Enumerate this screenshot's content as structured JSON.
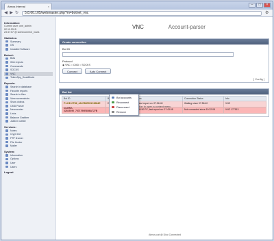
{
  "browser": {
    "tab_title": "Atmos Internal",
    "url": "5.8.60.105/webmaster.php?m=botnet_vnc"
  },
  "sidebar": {
    "info_heading": "Information:",
    "info_lines": [
      "Current user: one_admin",
      "02.11.2015",
      "23:47:57 @ someconnect_nows"
    ],
    "sections": [
      {
        "heading": "Statistics:",
        "items": [
          {
            "label": "Summary"
          },
          {
            "label": "OS"
          },
          {
            "label": "Installed Software"
          }
        ]
      },
      {
        "heading": "Botnet:",
        "items": [
          {
            "label": "Bots"
          },
          {
            "label": "Web Injects"
          },
          {
            "label": "Commands"
          },
          {
            "label": "SOCKS"
          },
          {
            "label": "VNC",
            "active": true
          },
          {
            "label": "TokenSpy_DeadMode"
          }
        ]
      },
      {
        "heading": "Reports:",
        "items": [
          {
            "label": "Search in database"
          },
          {
            "label": "Favorite reports"
          },
          {
            "label": "Search in files"
          },
          {
            "label": "View screenshots"
          },
          {
            "label": "Show videos"
          },
          {
            "label": "CMD Parser"
          },
          {
            "label": "Neurocoder"
          },
          {
            "label": "Links"
          },
          {
            "label": "Balance Grabber"
          },
          {
            "label": "Jabber notifier"
          }
        ]
      },
      {
        "heading": "Services:",
        "items": [
          {
            "label": "Notes"
          },
          {
            "label": "Crypt exe"
          },
          {
            "label": "FTP iframer"
          },
          {
            "label": "File Hunter"
          },
          {
            "label": "Mailer"
          }
        ]
      },
      {
        "heading": "System:",
        "items": [
          {
            "label": "Information"
          },
          {
            "label": "Options"
          },
          {
            "label": "User"
          },
          {
            "label": "Users"
          }
        ]
      },
      {
        "heading": "Logout",
        "items": []
      }
    ]
  },
  "page_tabs": {
    "vnc": "VNC",
    "account_parser": "Account-parser"
  },
  "create_panel": {
    "title": "Create connection",
    "bot_id_label": "Bot ID",
    "protocol_label": "Protocol",
    "radio_vnc": "VNC",
    "radio_cmd": "CMD",
    "radio_socks": "SOCKS",
    "connect_label": "Connect",
    "autoconnect_label": "Auto Connect",
    "config_label": "[ Config ]"
  },
  "botlist_panel": {
    "title": "Bot list",
    "columns": [
      "Bot ID",
      "Bot info",
      "Bot Status",
      "Connection Status",
      "Info"
    ],
    "rows": [
      {
        "bot_id": "P1-DE-CP86_4A0780E951C8384E",
        "bot_info": "DE, Vista SP 2",
        "bot_status": "Offline, last report on: 07:56:40",
        "conn_status": "Waiting since 07:56:40",
        "info": "VNC"
      },
      {
        "bot_id": "CLIENT-32819390_7671790E4B6A727B",
        "bot_info": "",
        "bot_status": "Online 35.50 PC, last report on: 07:43:08",
        "conn_status": "Not connected since 10:32:08",
        "info": "VNC 177513"
      }
    ],
    "hint": "... right mouse button to open a context menu"
  },
  "context_menu": {
    "items": [
      {
        "label": "Bot accounts"
      },
      {
        "label": "Reconnect"
      },
      {
        "label": "Disconnect"
      },
      {
        "label": "Remove"
      }
    ]
  },
  "footer": "Atmos.cat @ Disc Connected",
  "colors": {
    "panel_header": "#4d5e7a",
    "row_offline": "#f8d4d4",
    "row_online": "#fbb6b6",
    "sidebar_bg": "#eef1f6"
  }
}
